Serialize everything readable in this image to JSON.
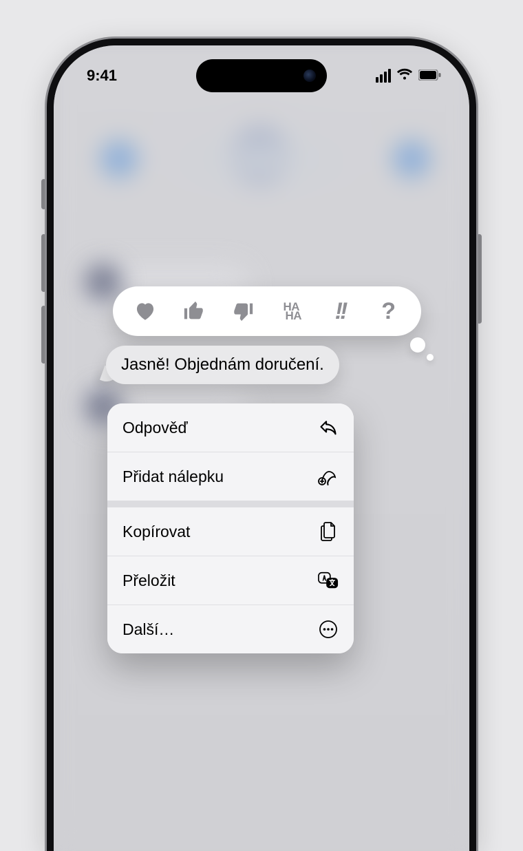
{
  "status": {
    "time": "9:41"
  },
  "tapback": {
    "heart": "heart",
    "thumbs_up": "thumbs-up",
    "thumbs_down": "thumbs-down",
    "haha_top": "HA",
    "haha_bottom": "HA",
    "emphasis": "!!",
    "question": "?"
  },
  "message": {
    "text": "Jasně! Objednám doručení."
  },
  "menu": {
    "reply": "Odpověď",
    "add_sticker": "Přidat nálepku",
    "copy": "Kopírovat",
    "translate": "Přeložit",
    "more": "Další…"
  }
}
